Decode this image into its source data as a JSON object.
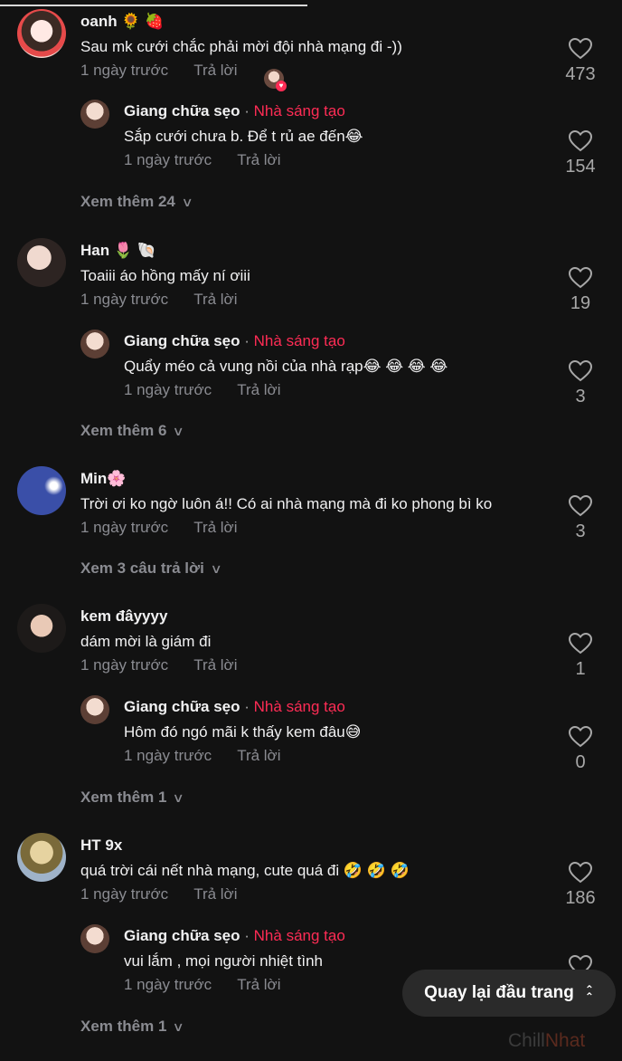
{
  "comments": [
    {
      "user": "oanh",
      "emojis": "🌻 🍓",
      "text": "Sau mk cưới chắc phải mời đội nhà mạng đi -))",
      "time": "1 ngày trước",
      "reply_label": "Trả lời",
      "likes": "473",
      "reply": {
        "user": "Giang chữa sẹo",
        "badge": "Nhà sáng tạo",
        "text": "Sắp cưới chưa b. Để t rủ ae đến😂",
        "time": "1 ngày trước",
        "reply_label": "Trả lời",
        "likes": "154"
      },
      "more": "Xem thêm 24"
    },
    {
      "user": "Han",
      "emojis": "🌷 🐚",
      "text": "Toaiii áo hồng mấy ní ơiii",
      "time": "1 ngày trước",
      "reply_label": "Trả lời",
      "likes": "19",
      "reply": {
        "user": "Giang chữa sẹo",
        "badge": "Nhà sáng tạo",
        "text": "Quẩy méo cả vung nồi của nhà rạp😂 😂 😂 😂",
        "time": "1 ngày trước",
        "reply_label": "Trả lời",
        "likes": "3"
      },
      "more": "Xem thêm 6"
    },
    {
      "user": "Min",
      "emojis": "🌸",
      "text": "Trời ơi ko ngờ luôn á!! Có ai nhà mạng mà đi ko phong bì ko",
      "time": "1 ngày trước",
      "reply_label": "Trả lời",
      "likes": "3",
      "more": "Xem 3 câu trả lời"
    },
    {
      "user": "kem đâyyyy",
      "emojis": "",
      "text": "dám mời là giám đi",
      "time": "1 ngày trước",
      "reply_label": "Trả lời",
      "likes": "1",
      "reply": {
        "user": "Giang chữa sẹo",
        "badge": "Nhà sáng tạo",
        "text": "Hôm đó ngó mãi k thấy kem đâu😅",
        "time": "1 ngày trước",
        "reply_label": "Trả lời",
        "likes": "0"
      },
      "more": "Xem thêm 1"
    },
    {
      "user": "HT 9x",
      "emojis": "",
      "text": "quá trời cái nết nhà mạng, cute quá đi 🤣 🤣 🤣",
      "time": "1 ngày trước",
      "reply_label": "Trả lời",
      "likes": "186",
      "reply": {
        "user": "Giang chữa sẹo",
        "badge": "Nhà sáng tạo",
        "text": "vui lắm , mọi người nhiệt tình",
        "time": "1 ngày trước",
        "reply_label": "Trả lời",
        "likes": ""
      },
      "more": "Xem thêm 1"
    }
  ],
  "back_to_top": "Quay lại đầu trang",
  "separator": "·",
  "watermark": {
    "part_a": "Chill",
    "part_b": "Nhat"
  },
  "colors": {
    "background": "#121212",
    "creator_badge": "#fe2c55",
    "muted": "#8a8b91"
  }
}
